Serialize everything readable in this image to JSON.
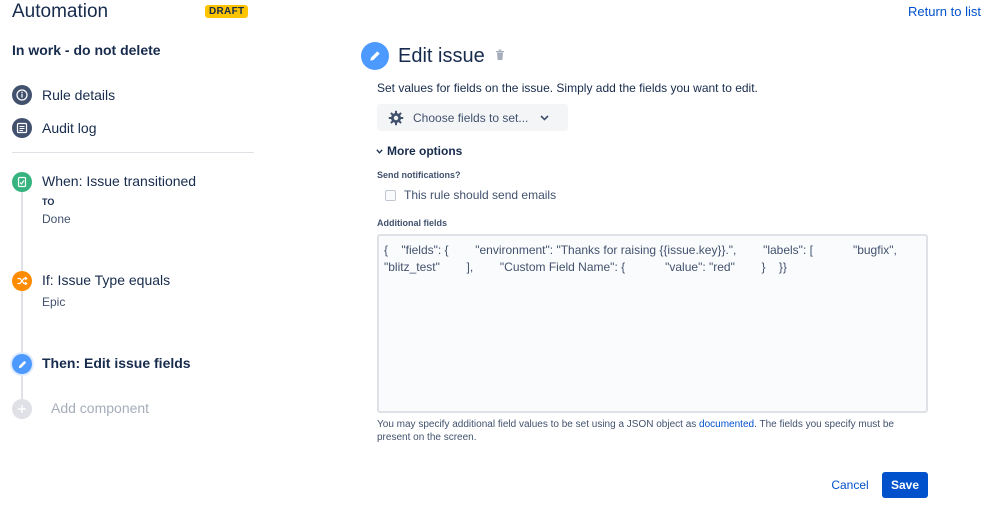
{
  "header": {
    "app_title": "Automation",
    "draft_badge": "DRAFT",
    "return_link": "Return to list"
  },
  "sidebar": {
    "rule_name": "In work - do not delete",
    "nav": [
      {
        "label": "Rule details",
        "icon": "info-icon"
      },
      {
        "label": "Audit log",
        "icon": "list-icon"
      }
    ],
    "steps": {
      "trigger": {
        "title": "When: Issue transitioned",
        "sub_label": "TO",
        "sub_value": "Done",
        "icon": "trigger-icon",
        "color": "#36B37E"
      },
      "condition": {
        "title": "If: Issue Type equals",
        "sub_value": "Epic",
        "icon": "shuffle-icon",
        "color": "#FF8B00"
      },
      "action": {
        "title": "Then: Edit issue fields",
        "icon": "pencil-icon",
        "color": "#4C9AFF"
      },
      "add": {
        "label": "Add component",
        "icon": "plus-icon",
        "color": "#DFE1E6"
      }
    }
  },
  "main": {
    "title": "Edit issue",
    "description": "Set values for fields on the issue. Simply add the fields you want to edit.",
    "choose_fields_button": "Choose fields to set...",
    "more_options": "More options",
    "send_notifications_label": "Send notifications?",
    "send_emails_checkbox": "This rule should send emails",
    "additional_fields_label": "Additional fields",
    "additional_fields_value": "{    \"fields\": {        \"environment\": \"Thanks for raising {{issue.key}}.\",        \"labels\": [            \"bugfix\",            \"blitz_test\"        ],        \"Custom Field Name\": {            \"value\": \"red\"        }    }}",
    "help_prefix": "You may specify additional field values to be set using a JSON object as ",
    "help_link": "documented",
    "help_suffix": ". The fields you specify must be present on the screen.",
    "cancel": "Cancel",
    "save": "Save"
  },
  "colors": {
    "accent": "#0052CC",
    "draft": "#FFC400",
    "nav_icon": "#42526E"
  }
}
